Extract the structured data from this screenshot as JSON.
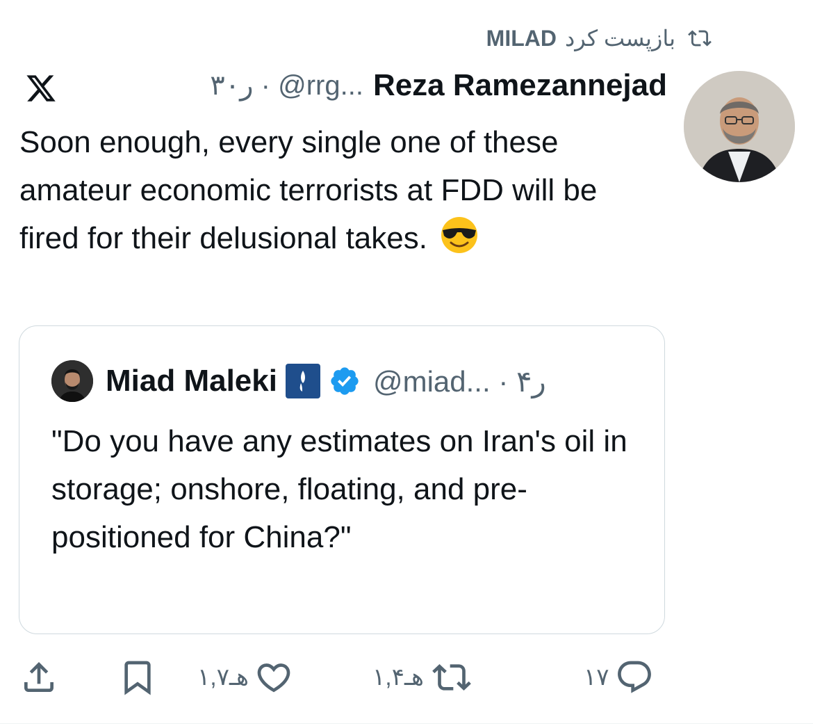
{
  "repost": {
    "user": "MILAD",
    "label": "بازپست کرد",
    "icon": "repost-icon"
  },
  "tweet": {
    "author_name": "Reza Ramezannejad",
    "handle_time": "ر۳۰ · @rrg...",
    "platform_icon": "x-logo-icon",
    "text": "Soon enough, every single one of these amateur economic terrorists at FDD will be fired for their delusional takes.",
    "emoji": "smiling-face-with-sunglasses"
  },
  "quote": {
    "author_name": "Miad Maleki",
    "handle_time": "@miad... · ر۴",
    "affiliate_icon": "organization-badge-icon",
    "verified_icon": "verified-badge-icon",
    "text": "\"Do you have any estimates on Iran's oil in storage; onshore, floating, and pre-positioned for China?\""
  },
  "actions": {
    "replies": "۱۷",
    "reposts": "۱,۴هـ",
    "likes": "۱,۷هـ"
  },
  "colors": {
    "text": "#0f1419",
    "muted": "#536471",
    "verified": "#1d9bf0",
    "border": "#cfd9de"
  }
}
